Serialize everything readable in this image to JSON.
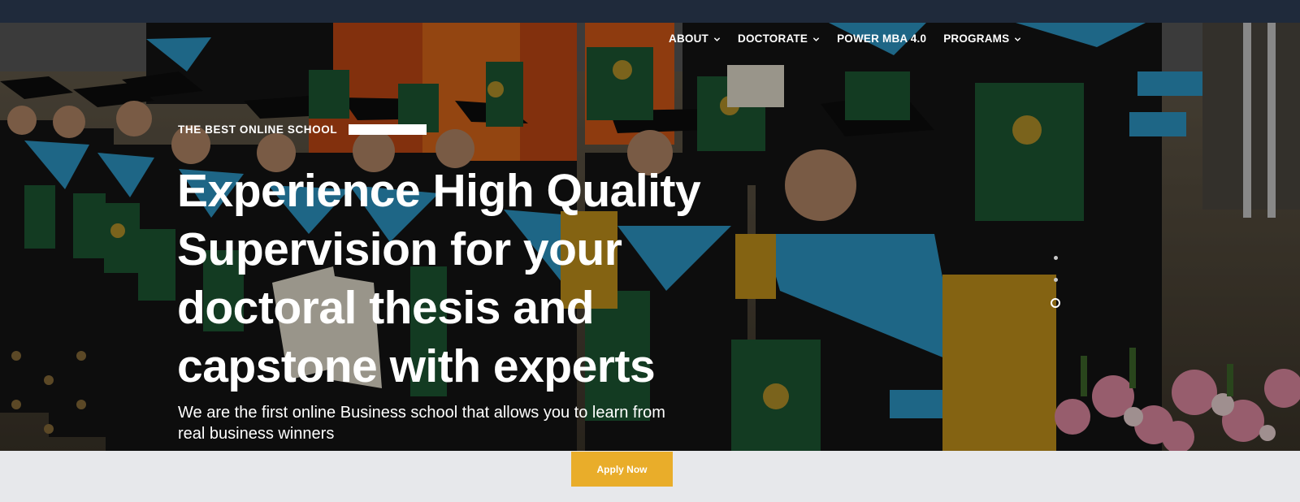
{
  "nav": {
    "items": [
      {
        "label": "ABOUT",
        "has_dropdown": true
      },
      {
        "label": "DOCTORATE",
        "has_dropdown": true
      },
      {
        "label": "POWER MBA 4.0",
        "has_dropdown": false
      },
      {
        "label": "PROGRAMS",
        "has_dropdown": true
      }
    ]
  },
  "hero": {
    "eyebrow": "THE BEST ONLINE SCHOOL",
    "headline_lines": [
      "Experience High Quality",
      "Supervision for your",
      "doctoral thesis and",
      "capstone with experts"
    ],
    "subline_lines": [
      "We are the first online Business school that allows you to learn from",
      "real business winners"
    ],
    "slider": {
      "total_slides": 3,
      "active_slide": 3
    }
  },
  "cta": {
    "apply_label": "Apply Now"
  },
  "colors": {
    "topbar": "#1f2a3b",
    "accent": "#e9ad2a",
    "page_bg": "#e7e8eb"
  }
}
